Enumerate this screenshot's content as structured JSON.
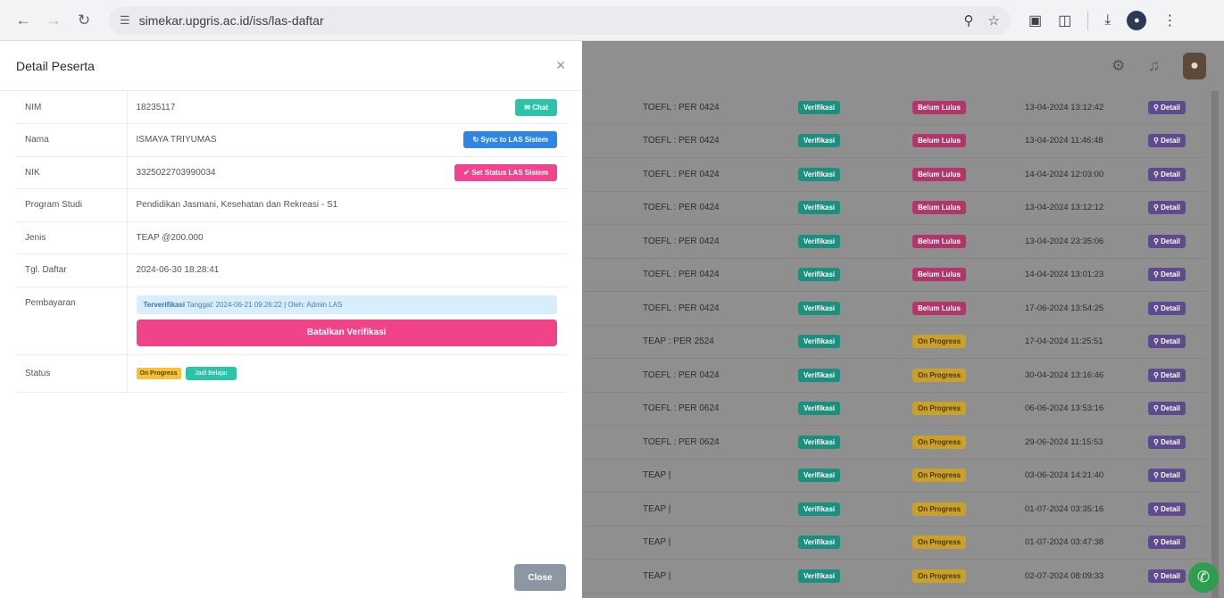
{
  "browser": {
    "url": "simekar.upgris.ac.id/iss/las-daftar",
    "icons": [
      "back-arrow-icon",
      "forward-arrow-icon",
      "reload-icon",
      "site-info-icon",
      "zoom-icon",
      "bookmark-star-icon",
      "screenshot-icon",
      "extensions-icon",
      "download-icon",
      "profile-icon",
      "menu-icon"
    ]
  },
  "background_table": {
    "rows": [
      {
        "test": "TOEFL : PER 0424",
        "verif": "Verifikasi",
        "status": "Belum Lulus",
        "date": "13-04-2024 13:12:42",
        "action": "Detail",
        "status_type": "red"
      },
      {
        "test": "TOEFL : PER 0424",
        "verif": "Verifikasi",
        "status": "Belum Lulus",
        "date": "13-04-2024 11:46:48",
        "action": "Detail",
        "status_type": "red"
      },
      {
        "test": "TOEFL : PER 0424",
        "verif": "Verifikasi",
        "status": "Belum Lulus",
        "date": "14-04-2024 12:03:00",
        "action": "Detail",
        "status_type": "red"
      },
      {
        "test": "TOEFL : PER 0424",
        "verif": "Verifikasi",
        "status": "Belum Lulus",
        "date": "13-04-2024 13:12:12",
        "action": "Detail",
        "status_type": "red"
      },
      {
        "test": "TOEFL : PER 0424",
        "verif": "Verifikasi",
        "status": "Belum Lulus",
        "date": "13-04-2024 23:35:06",
        "action": "Detail",
        "status_type": "red"
      },
      {
        "test": "TOEFL : PER 0424",
        "verif": "Verifikasi",
        "status": "Belum Lulus",
        "date": "14-04-2024 13:01:23",
        "action": "Detail",
        "status_type": "red"
      },
      {
        "test": "TOEFL : PER 0424",
        "verif": "Verifikasi",
        "status": "Belum Lulus",
        "date": "17-06-2024 13:54:25",
        "action": "Detail",
        "status_type": "red"
      },
      {
        "test": "TEAP : PER 2524",
        "verif": "Verifikasi",
        "status": "On Progress",
        "date": "17-04-2024 11:25:51",
        "action": "Detail",
        "status_type": "yellow"
      },
      {
        "test": "TOEFL : PER 0424",
        "verif": "Verifikasi",
        "status": "On Progress",
        "date": "30-04-2024 13:16:46",
        "action": "Detail",
        "status_type": "yellow"
      },
      {
        "test": "TOEFL : PER 0624",
        "verif": "Verifikasi",
        "status": "On Progress",
        "date": "06-06-2024 13:53:16",
        "action": "Detail",
        "status_type": "yellow"
      },
      {
        "test": "TOEFL : PER 0624",
        "verif": "Verifikasi",
        "status": "On Progress",
        "date": "29-06-2024 11:15:53",
        "action": "Detail",
        "status_type": "yellow"
      },
      {
        "test": "TEAP |",
        "verif": "Verifikasi",
        "status": "On Progress",
        "date": "03-06-2024 14:21:40",
        "action": "Detail",
        "status_type": "yellow"
      },
      {
        "test": "TEAP |",
        "verif": "Verifikasi",
        "status": "On Progress",
        "date": "01-07-2024 03:35:16",
        "action": "Detail",
        "status_type": "yellow"
      },
      {
        "test": "TEAP |",
        "verif": "Verifikasi",
        "status": "On Progress",
        "date": "01-07-2024 03:47:38",
        "action": "Detail",
        "status_type": "yellow"
      },
      {
        "test": "TEAP |",
        "verif": "Verifikasi",
        "status": "On Progress",
        "date": "02-07-2024 08:09:33",
        "action": "Detail",
        "status_type": "yellow"
      }
    ]
  },
  "modal": {
    "title": "Detail Peserta",
    "fields": {
      "nim": {
        "label": "NIM",
        "value": "18235117",
        "button": "Chat"
      },
      "nama": {
        "label": "Nama",
        "value": "ISMAYA TRIYUMAS",
        "button": "Sync to LAS Sistem"
      },
      "nik": {
        "label": "NIK",
        "value": "3325022703990034",
        "button": "Set Status LAS Sistem"
      },
      "prodi": {
        "label": "Program Studi",
        "value": "Pendidikan Jasmani, Kesehatan dan Rekreasi - S1"
      },
      "jenis": {
        "label": "Jenis",
        "value": "TEAP @200.000"
      },
      "tgl": {
        "label": "Tgl. Daftar",
        "value": "2024-06-30 18:28:41"
      },
      "pembayaran": {
        "label": "Pembayaran",
        "info_label": "Terverifikasi",
        "info_text": "Tanggal: 2024-06-21 09:26:22 | Oleh: Admin LAS",
        "cancel_button": "Batalkan Verifikasi"
      },
      "status": {
        "label": "Status",
        "badge": "On Progress",
        "button": "Jadi Belajar"
      }
    },
    "close_button": "Close"
  }
}
